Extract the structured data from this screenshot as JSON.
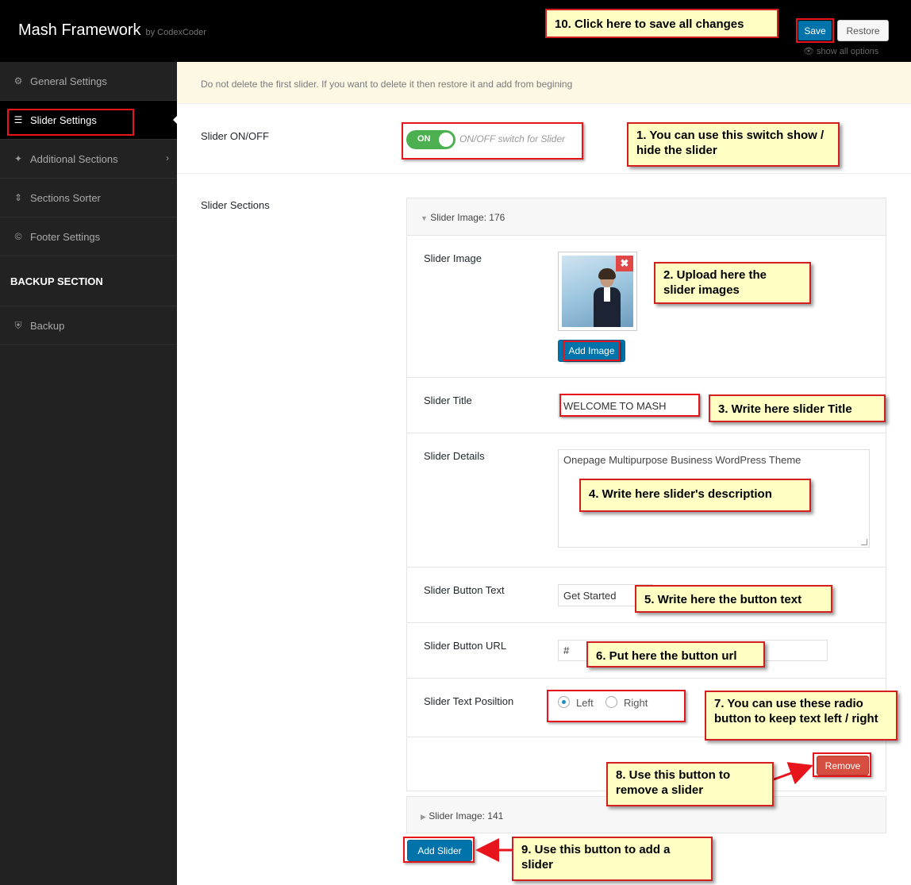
{
  "header": {
    "brand": "Mash Framework",
    "brand_by": "by CodexCoder",
    "save_label": "Save",
    "restore_label": "Restore",
    "show_all": "show all options"
  },
  "sidebar": {
    "items": [
      {
        "label": "General Settings",
        "icon": "gears-icon"
      },
      {
        "label": "Slider Settings",
        "icon": "sliders-icon"
      },
      {
        "label": "Additional Sections",
        "icon": "puzzle-icon"
      },
      {
        "label": "Sections Sorter",
        "icon": "sort-icon"
      },
      {
        "label": "Footer Settings",
        "icon": "copyright-icon"
      }
    ],
    "backup_heading": "BACKUP SECTION",
    "backup_item": "Backup"
  },
  "main": {
    "notice": "Do not delete the first slider. If you want to delete it then restore it and add from begining",
    "slider_onoff_label": "Slider ON/OFF",
    "toggle_on": "ON",
    "toggle_desc": "ON/OFF switch for Slider",
    "slider_sections_label": "Slider Sections"
  },
  "panel": {
    "title": "Slider Image: 176",
    "image_label": "Slider Image",
    "add_image": "Add Image",
    "title_label": "Slider Title",
    "title_value": "WELCOME TO MASH",
    "details_label": "Slider Details",
    "details_value": "Onepage Multipurpose Business WordPress Theme",
    "button_text_label": "Slider Button Text",
    "button_text_value": "Get Started",
    "button_url_label": "Slider Button URL",
    "button_url_value": "#",
    "position_label": "Slider Text Posiltion",
    "position_left": "Left",
    "position_right": "Right",
    "remove": "Remove"
  },
  "panel2": {
    "title": "Slider Image: 141"
  },
  "add_slider": "Add Slider",
  "notes": {
    "n1": "1. You can use this switch show / hide the slider",
    "n2": "2. Upload here the slider images",
    "n3": "3. Write here slider Title",
    "n4": "4. Write here slider's description",
    "n5": "5. Write here the button text",
    "n6": "6. Put here the button url",
    "n7": "7. You can use these radio button to keep text left / right",
    "n8": "8. Use this button to remove a slider",
    "n9": "9. Use this button to add a slider",
    "n10": "10. Click here to save all changes"
  },
  "colors": {
    "primary": "#0073aa",
    "danger": "#d54e3f",
    "toggle_on": "#4caf50",
    "note_bg": "#ffffc4",
    "highlight": "#e8141c"
  }
}
